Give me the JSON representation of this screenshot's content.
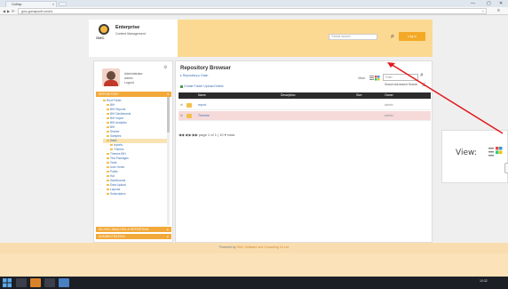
{
  "browser": {
    "tab_title": "GoMap",
    "tab_close": "×",
    "url": "gmc.gomapsoft.com/ui",
    "minimize": "—",
    "maximize": "▢",
    "close": "✕",
    "back": "◀",
    "forward": "▶",
    "reload": "⟳",
    "star": "☆",
    "menu": "≡"
  },
  "header": {
    "brand": "Enterprise",
    "brand_sub": "Content Management",
    "logo_text": "GMC",
    "search_placeholder": "Global search",
    "signin_label": "Log in"
  },
  "sidebar": {
    "user_name": "Administrator",
    "user_role": "admin",
    "user_status": "Logout",
    "repository_section": "REPOSITORY",
    "tree": [
      {
        "label": "Root Folder",
        "indent": 0
      },
      {
        "label": "BIH",
        "indent": 1
      },
      {
        "label": "BIH Reports",
        "indent": 1
      },
      {
        "label": "BIH Dashboards",
        "indent": 1
      },
      {
        "label": "BIH Import",
        "indent": 1
      },
      {
        "label": "BIH Analytics",
        "indent": 1
      },
      {
        "label": "BIH",
        "indent": 1
      },
      {
        "label": "Shared",
        "indent": 1
      },
      {
        "label": "Samples",
        "indent": 1
      },
      {
        "label": "Dash",
        "indent": 1,
        "selected": true
      },
      {
        "label": "reports",
        "indent": 2
      },
      {
        "label": "Themes",
        "indent": 2
      },
      {
        "label": "Themes BIH",
        "indent": 1
      },
      {
        "label": "Test Packages",
        "indent": 1
      },
      {
        "label": "Tests",
        "indent": 1
      },
      {
        "label": "User Home",
        "indent": 1
      },
      {
        "label": "Public",
        "indent": 1
      },
      {
        "label": "Hal",
        "indent": 1
      },
      {
        "label": "Dashboards",
        "indent": 1
      },
      {
        "label": "Data Upload",
        "indent": 1
      },
      {
        "label": "Layouts",
        "indent": 1
      },
      {
        "label": "Subscription",
        "indent": 1
      }
    ],
    "adhoc_section": "AD-HOC ANALYSIS & REPORTING",
    "admin_section": "ADMINISTRATION"
  },
  "main": {
    "title": "Repository Browser",
    "breadcrumb": "▸ Repository ▸ Dash",
    "view_label": "View:",
    "filter_placeholder": "Filter",
    "toolbar": "Create Folder  Upload  Delete",
    "advanced_search": "Search   Advanced Search",
    "columns": {
      "name": "Name",
      "description": "Description",
      "size": "Size",
      "owner": "Owner"
    },
    "rows": [
      {
        "name": "report",
        "owner": "admin"
      },
      {
        "name": "Themes",
        "owner": "admin"
      }
    ],
    "pager": "◀◀  ◀   ▶  ▶▶  page 1 of 1   |  10 ▾ rows",
    "expand_icon": "⊕"
  },
  "footer": {
    "prefix": "Powered by",
    "company": "GMC Software and Consulting Co Ltd"
  },
  "callout": {
    "label": "View:"
  },
  "taskbar": {
    "time": "10:32"
  }
}
